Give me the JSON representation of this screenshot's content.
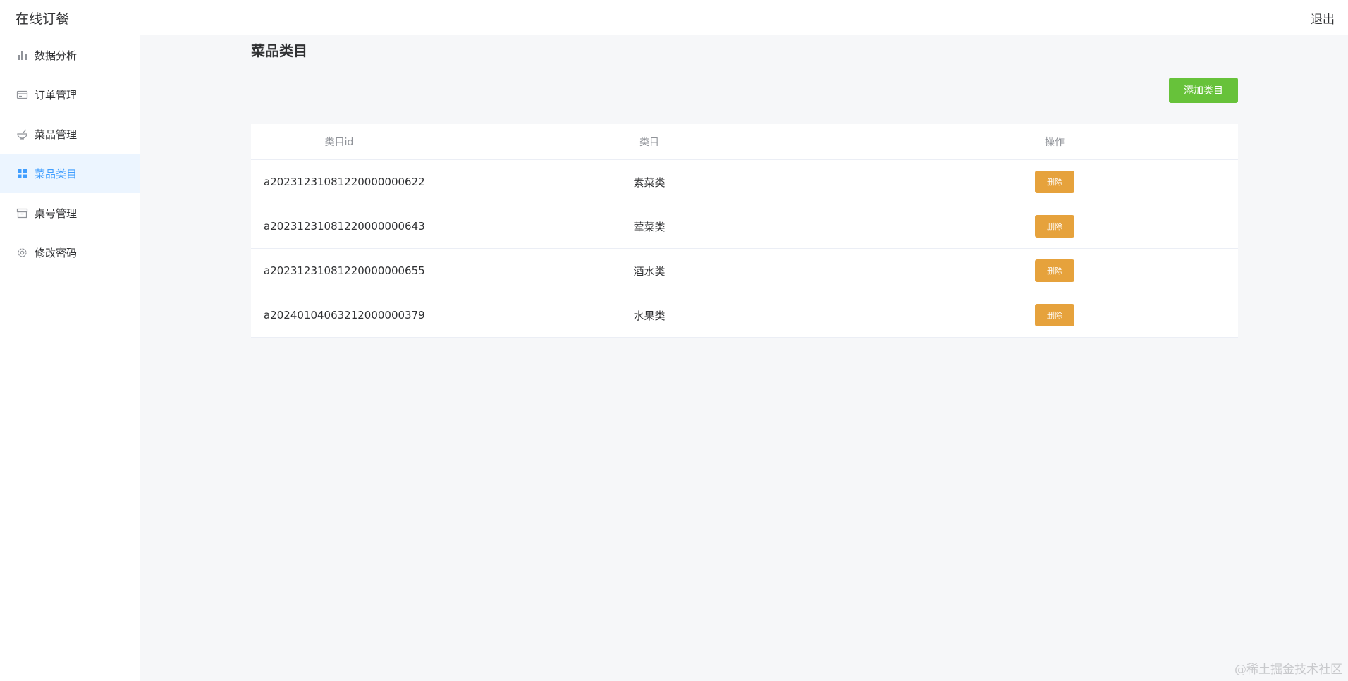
{
  "header": {
    "title": "在线订餐",
    "logout_label": "退出"
  },
  "sidebar": {
    "items": [
      {
        "label": "数据分析",
        "icon": "bar-chart-icon"
      },
      {
        "label": "订单管理",
        "icon": "card-icon"
      },
      {
        "label": "菜品管理",
        "icon": "bowl-icon"
      },
      {
        "label": "菜品类目",
        "icon": "grid-icon",
        "active": true
      },
      {
        "label": "桌号管理",
        "icon": "box-icon"
      },
      {
        "label": "修改密码",
        "icon": "gear-icon"
      }
    ]
  },
  "main": {
    "title": "菜品类目",
    "add_label": "添加类目",
    "table": {
      "headers": [
        "类目id",
        "类目",
        "操作"
      ],
      "rows": [
        {
          "id": "a20231231081220000000622",
          "name": "素菜类",
          "action": "删除"
        },
        {
          "id": "a20231231081220000000643",
          "name": "荤菜类",
          "action": "删除"
        },
        {
          "id": "a20231231081220000000655",
          "name": "酒水类",
          "action": "删除"
        },
        {
          "id": "a20240104063212000000379",
          "name": "水果类",
          "action": "删除"
        }
      ]
    }
  },
  "watermark": "@稀土掘金技术社区",
  "colors": {
    "accent": "#409eff",
    "success": "#67c23a",
    "warning": "#e6a23c"
  }
}
